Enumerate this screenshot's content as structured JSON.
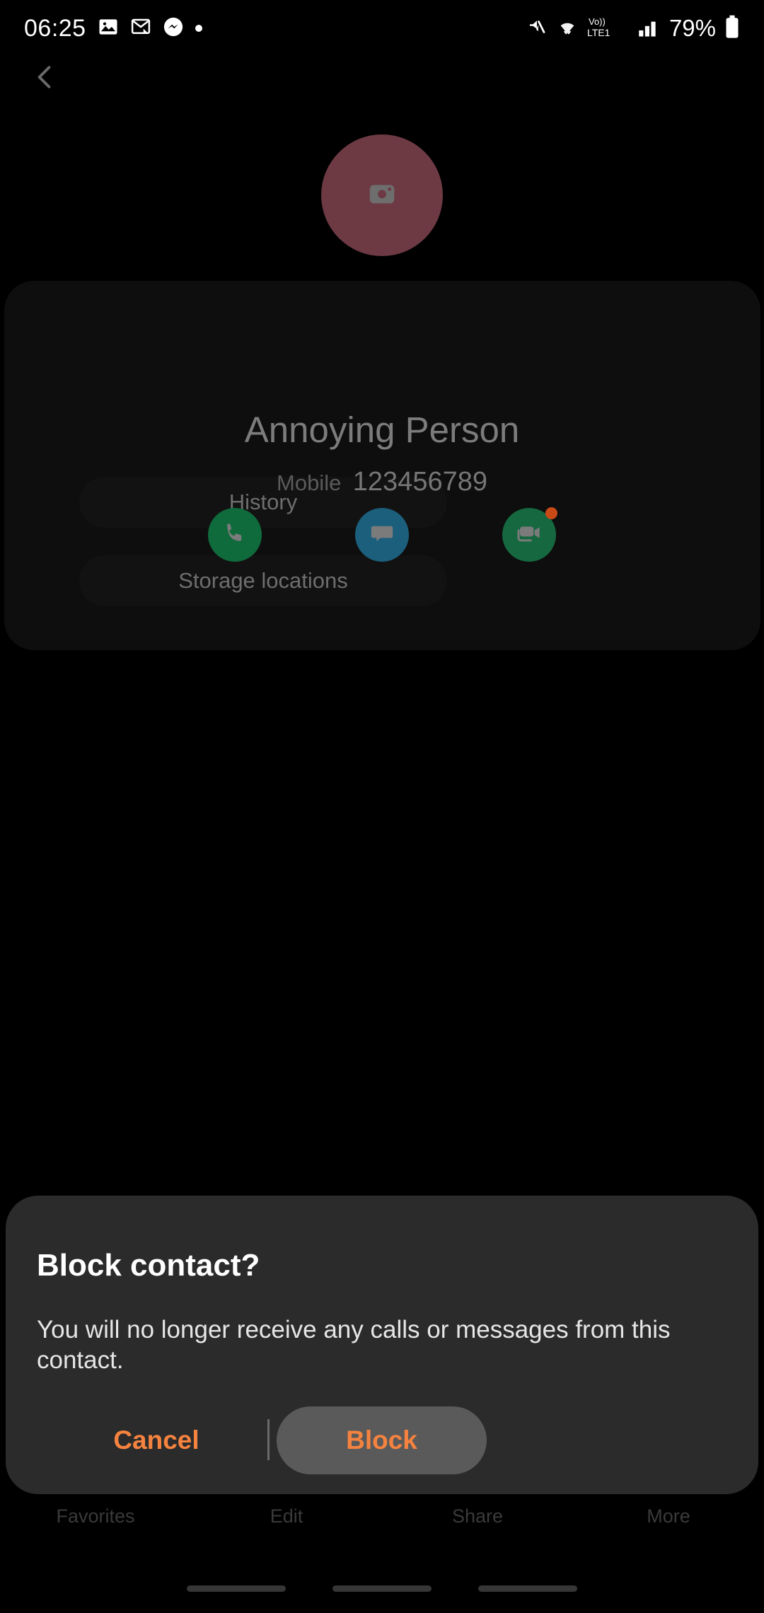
{
  "status_bar": {
    "time": "06:25",
    "battery_percent": "79%",
    "network_label": "LTE1",
    "volte_label": "Vo))",
    "left_icons": [
      "gallery-icon",
      "email-icon",
      "messenger-icon",
      "dot-indicator"
    ],
    "right_icons": [
      "mute-icon",
      "wifi-icon",
      "volte-icon",
      "signal-bars-icon",
      "battery-icon"
    ]
  },
  "nav": {
    "back_icon": "back-chevron-icon"
  },
  "contact": {
    "name": "Annoying Person",
    "number_label": "Mobile",
    "number": "123456789",
    "avatar_icon": "camera-icon",
    "avatar_color": "#6d3a44",
    "actions": [
      {
        "name": "call",
        "icon": "phone-icon",
        "color": "#0f6b3c"
      },
      {
        "name": "message",
        "icon": "speech-bubble-icon",
        "color": "#1c5f7d"
      },
      {
        "name": "video-call",
        "icon": "video-camera-icon",
        "color": "#15683f",
        "badge": true,
        "badge_color": "#c94a16"
      }
    ]
  },
  "sections": {
    "history_label": "History",
    "storage_label": "Storage locations"
  },
  "bottom_nav": {
    "items": [
      {
        "label": "Favorites"
      },
      {
        "label": "Edit"
      },
      {
        "label": "Share"
      },
      {
        "label": "More"
      }
    ]
  },
  "dialog": {
    "title": "Block contact?",
    "body": "You will no longer receive any calls or messages from this contact.",
    "cancel_label": "Cancel",
    "block_label": "Block",
    "accent_color": "#f5833f",
    "surface_color": "#2b2b2b",
    "block_button_bg": "#5a5a5a"
  }
}
